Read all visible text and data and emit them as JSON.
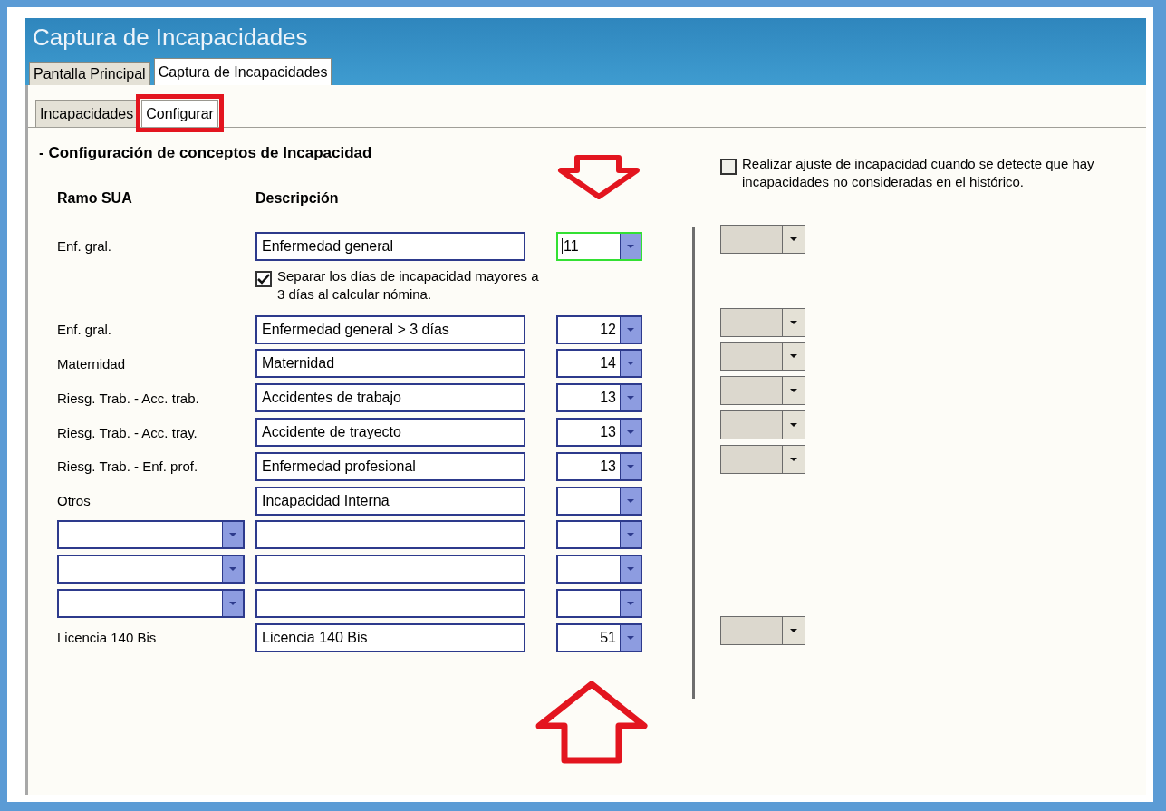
{
  "window": {
    "title": "Captura de Incapacidades"
  },
  "main_tabs": [
    {
      "label": "Pantalla Principal",
      "selected": false
    },
    {
      "label": "Captura de Incapacidades",
      "selected": true
    }
  ],
  "sub_tabs": [
    {
      "label": "Incapacidades",
      "selected": false,
      "highlighted": false
    },
    {
      "label": "Configurar",
      "selected": true,
      "highlighted": true
    }
  ],
  "section_title": "- Configuración de conceptos de Incapacidad",
  "columns": {
    "ramo": "Ramo SUA",
    "descripcion": "Descripción"
  },
  "adjust_option": {
    "label": "Realizar ajuste de incapacidad cuando se detecte que hay incapacidades no consideradas en el histórico.",
    "checked": false
  },
  "rows": [
    {
      "ramo": {
        "kind": "label",
        "text": "Enf. gral."
      },
      "descripcion": "Enfermedad general",
      "code": {
        "value": "11",
        "focused": true
      },
      "extra_combo": {
        "disabled": true
      },
      "option": {
        "label": "Separar los días de incapacidad mayores a 3 días al calcular nómina.",
        "checked": true
      }
    },
    {
      "ramo": {
        "kind": "label",
        "text": "Enf. gral."
      },
      "descripcion": "Enfermedad general > 3 días",
      "code": {
        "value": "12",
        "focused": false
      },
      "extra_combo": {
        "disabled": true
      }
    },
    {
      "ramo": {
        "kind": "label",
        "text": "Maternidad"
      },
      "descripcion": "Maternidad",
      "code": {
        "value": "14",
        "focused": false
      },
      "extra_combo": {
        "disabled": true
      }
    },
    {
      "ramo": {
        "kind": "label",
        "text": "Riesg. Trab. - Acc. trab."
      },
      "descripcion": "Accidentes de trabajo",
      "code": {
        "value": "13",
        "focused": false
      },
      "extra_combo": {
        "disabled": true
      }
    },
    {
      "ramo": {
        "kind": "label",
        "text": "Riesg. Trab. - Acc. tray."
      },
      "descripcion": "Accidente de trayecto",
      "code": {
        "value": "13",
        "focused": false
      },
      "extra_combo": {
        "disabled": true
      }
    },
    {
      "ramo": {
        "kind": "label",
        "text": "Riesg. Trab. -  Enf. prof."
      },
      "descripcion": "Enfermedad profesional",
      "code": {
        "value": "13",
        "focused": false
      },
      "extra_combo": {
        "disabled": true
      }
    },
    {
      "ramo": {
        "kind": "label",
        "text": "Otros"
      },
      "descripcion": "Incapacidad Interna",
      "code": {
        "focused": false
      }
    },
    {
      "ramo": {
        "kind": "select"
      },
      "code": {
        "focused": false
      }
    },
    {
      "ramo": {
        "kind": "select"
      },
      "code": {
        "focused": false
      }
    },
    {
      "ramo": {
        "kind": "select"
      },
      "code": {
        "focused": false
      }
    },
    {
      "ramo": {
        "kind": "label",
        "text": "Licencia 140 Bis"
      },
      "descripcion": "Licencia 140 Bis",
      "code": {
        "value": "51",
        "focused": false
      },
      "extra_combo": {
        "disabled": true
      }
    }
  ]
}
